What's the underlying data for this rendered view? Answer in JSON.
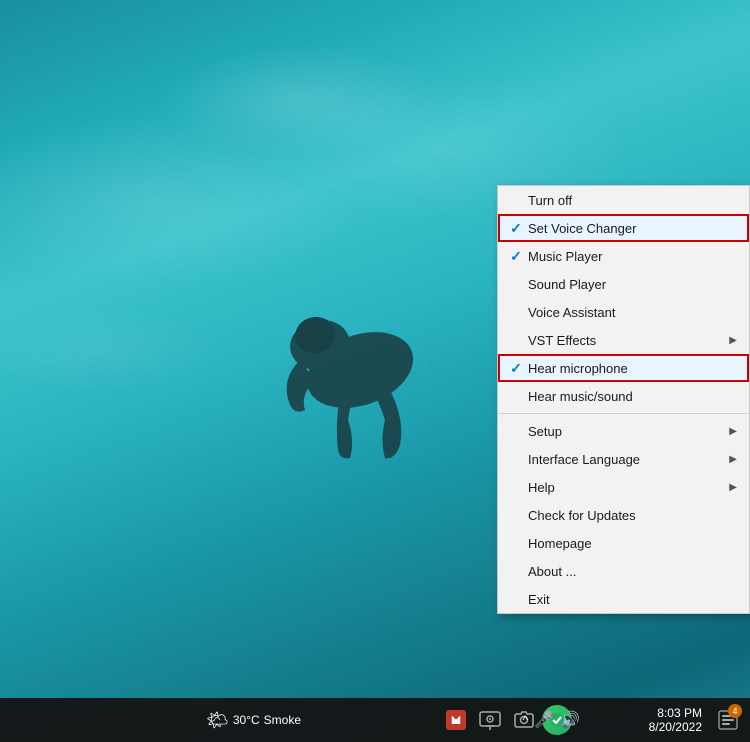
{
  "desktop": {
    "background_desc": "Underwater elephant swimming in teal water"
  },
  "context_menu": {
    "items": [
      {
        "id": "turn-off",
        "label": "Turn off",
        "check": false,
        "has_submenu": false,
        "highlighted": false,
        "separator_after": false
      },
      {
        "id": "set-voice-changer",
        "label": "Set Voice Changer",
        "check": true,
        "has_submenu": false,
        "highlighted": true,
        "separator_after": false
      },
      {
        "id": "music-player",
        "label": "Music Player",
        "check": true,
        "has_submenu": false,
        "highlighted": false,
        "separator_after": false
      },
      {
        "id": "sound-player",
        "label": "Sound Player",
        "check": false,
        "has_submenu": false,
        "highlighted": false,
        "separator_after": false
      },
      {
        "id": "voice-assistant",
        "label": "Voice Assistant",
        "check": false,
        "has_submenu": false,
        "highlighted": false,
        "separator_after": false
      },
      {
        "id": "vst-effects",
        "label": "VST Effects",
        "check": false,
        "has_submenu": true,
        "highlighted": false,
        "separator_after": false
      },
      {
        "id": "hear-microphone",
        "label": "Hear microphone",
        "check": true,
        "has_submenu": false,
        "highlighted": true,
        "separator_after": false
      },
      {
        "id": "hear-music-sound",
        "label": "Hear music/sound",
        "check": false,
        "has_submenu": false,
        "highlighted": false,
        "separator_after": true
      },
      {
        "id": "setup",
        "label": "Setup",
        "check": false,
        "has_submenu": true,
        "highlighted": false,
        "separator_after": false
      },
      {
        "id": "interface-language",
        "label": "Interface Language",
        "check": false,
        "has_submenu": true,
        "highlighted": false,
        "separator_after": false
      },
      {
        "id": "help",
        "label": "Help",
        "check": false,
        "has_submenu": true,
        "highlighted": false,
        "separator_after": false
      },
      {
        "id": "check-for-updates",
        "label": "Check for Updates",
        "check": false,
        "has_submenu": false,
        "highlighted": false,
        "separator_after": false
      },
      {
        "id": "homepage",
        "label": "Homepage",
        "check": false,
        "has_submenu": false,
        "highlighted": false,
        "separator_after": false
      },
      {
        "id": "about",
        "label": "About ...",
        "check": false,
        "has_submenu": false,
        "highlighted": false,
        "separator_after": false
      },
      {
        "id": "exit",
        "label": "Exit",
        "check": false,
        "has_submenu": false,
        "highlighted": false,
        "separator_after": false
      }
    ]
  },
  "taskbar": {
    "weather_icon": "🌤",
    "weather_temp": "30°C",
    "weather_condition": "Smoke",
    "chevron": "^",
    "mic_icon": "🎤",
    "volume_icon": "🔊",
    "clock_time": "8:03 PM",
    "clock_date": "8/20/2022",
    "notification_count": "4"
  }
}
